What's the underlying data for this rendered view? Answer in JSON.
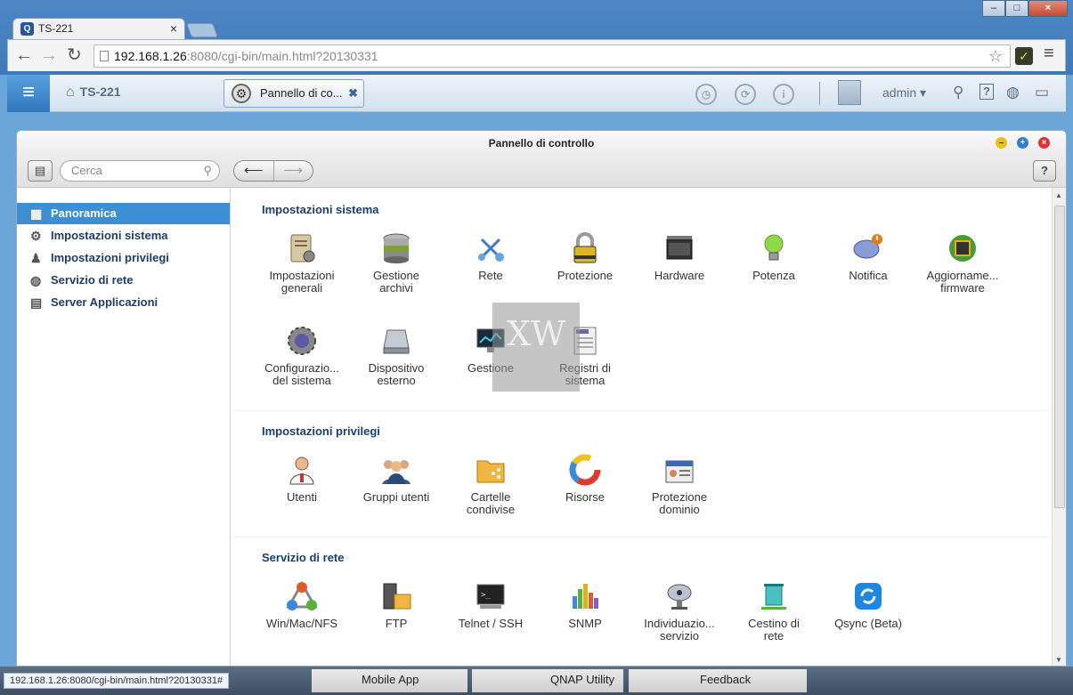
{
  "browser": {
    "tab_title": "TS-221",
    "tab_icon_letter": "Q",
    "url_host": "192.168.1.26",
    "url_rest": ":8080/cgi-bin/main.html?20130331",
    "status_url": "192.168.1.26:8080/cgi-bin/main.html?20130331#"
  },
  "qnap": {
    "home_label": "TS-221",
    "app_tab_label": "Pannello di co...",
    "user": "admin"
  },
  "window": {
    "title": "Pannello di controllo",
    "search_placeholder": "Cerca"
  },
  "sidebar": {
    "items": [
      {
        "label": "Panoramica",
        "icon": "grid-icon"
      },
      {
        "label": "Impostazioni sistema",
        "icon": "gear-icon"
      },
      {
        "label": "Impostazioni privilegi",
        "icon": "user-icon"
      },
      {
        "label": "Servizio di rete",
        "icon": "globe-icon"
      },
      {
        "label": "Server Applicazioni",
        "icon": "server-icon"
      }
    ]
  },
  "sections": [
    {
      "title": "Impostazioni sistema",
      "items": [
        {
          "l1": "Impostazioni",
          "l2": "generali"
        },
        {
          "l1": "Gestione",
          "l2": "archivi"
        },
        {
          "l1": "Rete",
          "l2": ""
        },
        {
          "l1": "Protezione",
          "l2": ""
        },
        {
          "l1": "Hardware",
          "l2": ""
        },
        {
          "l1": "Potenza",
          "l2": ""
        },
        {
          "l1": "Notifica",
          "l2": ""
        },
        {
          "l1": "Aggiorname...",
          "l2": "firmware"
        },
        {
          "l1": "Configurazio...",
          "l2": "del sistema"
        },
        {
          "l1": "Dispositivo",
          "l2": "esterno"
        },
        {
          "l1": "Gestione",
          "l2": ""
        },
        {
          "l1": "Registri di",
          "l2": "sistema"
        }
      ]
    },
    {
      "title": "Impostazioni privilegi",
      "items": [
        {
          "l1": "Utenti",
          "l2": ""
        },
        {
          "l1": "Gruppi utenti",
          "l2": ""
        },
        {
          "l1": "Cartelle",
          "l2": "condivise"
        },
        {
          "l1": "Risorse",
          "l2": ""
        },
        {
          "l1": "Protezione",
          "l2": "dominio"
        }
      ]
    },
    {
      "title": "Servizio di rete",
      "items": [
        {
          "l1": "Win/Mac/NFS",
          "l2": ""
        },
        {
          "l1": "FTP",
          "l2": ""
        },
        {
          "l1": "Telnet / SSH",
          "l2": ""
        },
        {
          "l1": "SNMP",
          "l2": ""
        },
        {
          "l1": "Individuazio...",
          "l2": "servizio"
        },
        {
          "l1": "Cestino di",
          "l2": "rete"
        },
        {
          "l1": "Qsync (Beta)",
          "l2": ""
        }
      ]
    }
  ],
  "watermark_text": "XW",
  "bottom_bar": {
    "mobile_app": "Mobile App",
    "qnap_utility": "QNAP Utility",
    "feedback": "Feedback"
  },
  "colors": {
    "accent": "#3c8fd4",
    "section_title": "#1a3e6d"
  }
}
